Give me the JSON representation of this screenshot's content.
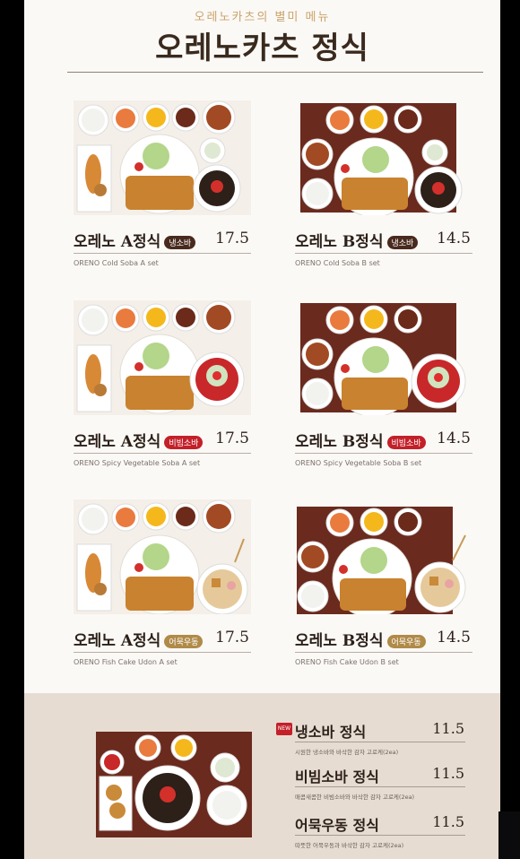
{
  "header": {
    "subtitle": "오레노카츠의 별미 메뉴",
    "title": "오레노카츠 정식"
  },
  "items": [
    {
      "name": "오레노 A정식",
      "badge": "냉소바",
      "price": "17.5",
      "en": "ORENO Cold Soba A set"
    },
    {
      "name": "오레노 B정식",
      "badge": "냉소바",
      "price": "14.5",
      "en": "ORENO Cold Soba B set"
    },
    {
      "name": "오레노 A정식",
      "badge": "비빔소바",
      "price": "17.5",
      "en": "ORENO Spicy Vegetable  Soba  A set"
    },
    {
      "name": "오레노 B정식",
      "badge": "비빔소바",
      "price": "14.5",
      "en": "ORENO Spicy Vegetable  Soba  B set"
    },
    {
      "name": "오레노 A정식",
      "badge": "어묵우동",
      "price": "17.5",
      "en": "ORENO Fish Cake Udon A set"
    },
    {
      "name": "오레노 B정식",
      "badge": "어묵우동",
      "price": "14.5",
      "en": "ORENO Fish Cake Udon B set"
    }
  ],
  "bottom": {
    "new_label": "NEW",
    "items": [
      {
        "name": "냉소바 정식",
        "price": "11.5",
        "desc": "시원한 냉소바와 바삭한 감자 고로케(2ea)"
      },
      {
        "name": "비빔소바 정식",
        "price": "11.5",
        "desc": "매콤새콤한 비빔소바와 바삭한 감자 고로케(2ea)"
      },
      {
        "name": "어묵우동 정식",
        "price": "11.5",
        "desc": "따뜻한 어묵우동과 바삭한 감자 고로케(2ea)"
      }
    ]
  },
  "colors": {
    "title": "#3a2a1e",
    "accent": "#c9a36a",
    "badge_soba": "#4a2a1e",
    "badge_bibim": "#c3202a",
    "badge_udon": "#b08a48"
  }
}
